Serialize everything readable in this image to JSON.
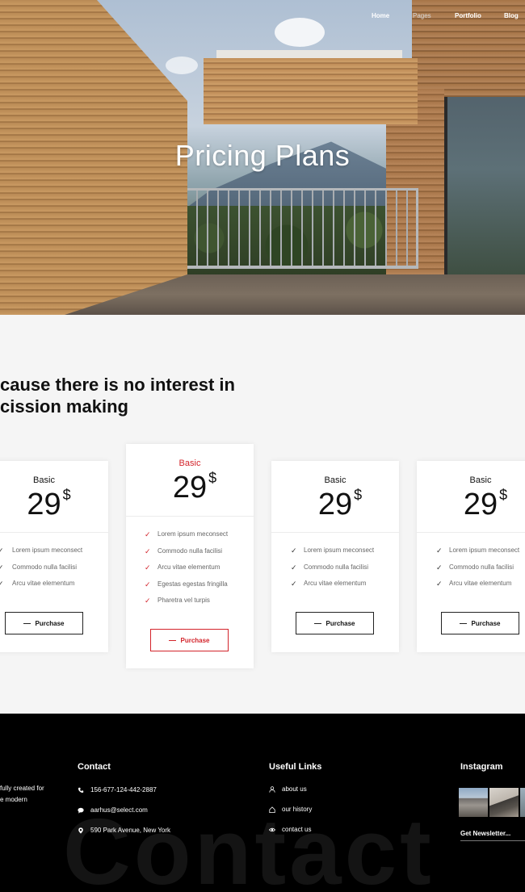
{
  "nav": {
    "items": [
      "Home",
      "Pages",
      "Portfolio",
      "Blog"
    ]
  },
  "hero": {
    "title": "Pricing Plans"
  },
  "section": {
    "heading_line1": "cause there is no interest in",
    "heading_line2": "cission making"
  },
  "plans": [
    {
      "name": "Basic",
      "price": "29",
      "currency": "$",
      "features": [
        "Lorem ipsum meconsect",
        "Commodo nulla facilisi",
        "Arcu vitae elementum"
      ],
      "button": "Purchase"
    },
    {
      "name": "Basic",
      "price": "29",
      "currency": "$",
      "features": [
        "Lorem ipsum meconsect",
        "Commodo nulla facilisi",
        "Arcu vitae elementum",
        "Egestas egestas fringilla",
        "Pharetra vel turpis"
      ],
      "button": "Purchase"
    },
    {
      "name": "Basic",
      "price": "29",
      "currency": "$",
      "features": [
        "Lorem ipsum meconsect",
        "Commodo nulla facilisi",
        "Arcu vitae elementum"
      ],
      "button": "Purchase"
    },
    {
      "name": "Basic",
      "price": "29",
      "currency": "$",
      "features": [
        "Lorem ipsum meconsect",
        "Commodo nulla facilisi",
        "Arcu vitae elementum"
      ],
      "button": "Purchase"
    }
  ],
  "colors": {
    "accent": "#d3242b",
    "footer_bg": "#000000"
  },
  "footer": {
    "about_line1": "fully created for",
    "about_line2": "e modern",
    "contact_title": "Contact",
    "phone": "156-677-124-442-2887",
    "email": "aarhus@select.com",
    "address": "590 Park Avenue, New York",
    "links_title": "Useful Links",
    "links": [
      "about us",
      "our history",
      "contact us"
    ],
    "instagram_title": "Instagram",
    "newsletter": "Get Newsletter...",
    "watermark": "Contact",
    "icons": [
      "phone-icon",
      "mail-icon",
      "location-pin-icon",
      "user-icon",
      "home-icon",
      "eye-icon"
    ]
  }
}
